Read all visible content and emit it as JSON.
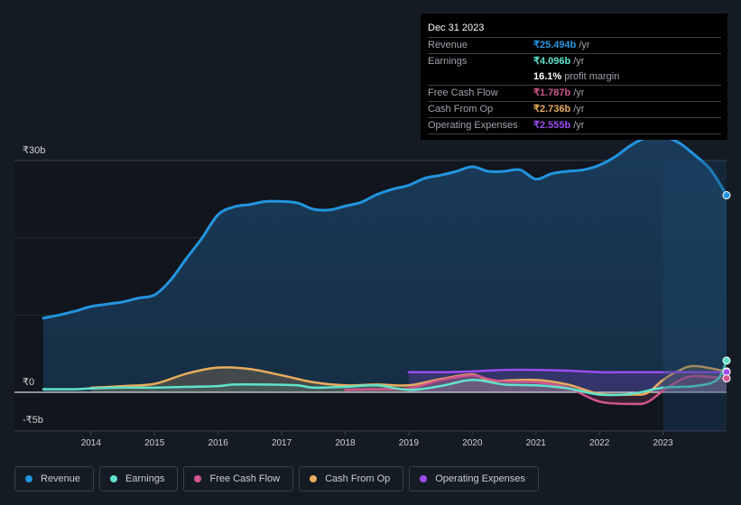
{
  "tooltip": {
    "date": "Dec 31 2023",
    "rows": [
      {
        "label": "Revenue",
        "value": "₹25.494b",
        "unit": "/yr",
        "color": "#2394df"
      },
      {
        "label": "Earnings",
        "value": "₹4.096b",
        "unit": "/yr",
        "color": "#5fe3cd"
      },
      {
        "label": "",
        "value": "16.1%",
        "unit": "profit margin",
        "color": "#ffffff"
      },
      {
        "label": "Free Cash Flow",
        "value": "₹1.787b",
        "unit": "/yr",
        "color": "#d1568e"
      },
      {
        "label": "Cash From Op",
        "value": "₹2.736b",
        "unit": "/yr",
        "color": "#e8ac5e"
      },
      {
        "label": "Operating Expenses",
        "value": "₹2.555b",
        "unit": "/yr",
        "color": "#9d4cf0"
      }
    ]
  },
  "legend": [
    {
      "label": "Revenue",
      "color": "#2394df"
    },
    {
      "label": "Earnings",
      "color": "#5fe3cd"
    },
    {
      "label": "Free Cash Flow",
      "color": "#d1568e"
    },
    {
      "label": "Cash From Op",
      "color": "#e8ac5e"
    },
    {
      "label": "Operating Expenses",
      "color": "#9d4cf0"
    }
  ],
  "chart_data": {
    "type": "area",
    "title": "",
    "xlabel": "",
    "ylabel": "",
    "ylim": [
      -5,
      30
    ],
    "xlim": [
      2013.25,
      2024.0
    ],
    "y_ticks": [
      {
        "value": 30,
        "label": "₹30b"
      },
      {
        "value": 0,
        "label": "₹0"
      },
      {
        "value": -5,
        "label": "-₹5b"
      }
    ],
    "x_ticks": [
      "2014",
      "2015",
      "2016",
      "2017",
      "2018",
      "2019",
      "2020",
      "2021",
      "2022",
      "2023"
    ],
    "highlight_from": 2023.0,
    "grid": true,
    "series": [
      {
        "name": "Revenue",
        "color": "#2394df",
        "points": [
          [
            2013.25,
            9.6
          ],
          [
            2013.5,
            10.0
          ],
          [
            2013.75,
            10.5
          ],
          [
            2014.0,
            11.1
          ],
          [
            2014.25,
            11.4
          ],
          [
            2014.5,
            11.7
          ],
          [
            2014.75,
            12.2
          ],
          [
            2015.0,
            12.6
          ],
          [
            2015.25,
            14.5
          ],
          [
            2015.5,
            17.3
          ],
          [
            2015.75,
            20.0
          ],
          [
            2016.0,
            23.0
          ],
          [
            2016.25,
            24.0
          ],
          [
            2016.5,
            24.3
          ],
          [
            2016.75,
            24.7
          ],
          [
            2017.0,
            24.7
          ],
          [
            2017.25,
            24.5
          ],
          [
            2017.5,
            23.7
          ],
          [
            2017.75,
            23.6
          ],
          [
            2018.0,
            24.1
          ],
          [
            2018.25,
            24.6
          ],
          [
            2018.5,
            25.6
          ],
          [
            2018.75,
            26.3
          ],
          [
            2019.0,
            26.8
          ],
          [
            2019.25,
            27.7
          ],
          [
            2019.5,
            28.1
          ],
          [
            2019.75,
            28.6
          ],
          [
            2020.0,
            29.2
          ],
          [
            2020.25,
            28.6
          ],
          [
            2020.5,
            28.6
          ],
          [
            2020.75,
            28.8
          ],
          [
            2021.0,
            27.6
          ],
          [
            2021.25,
            28.3
          ],
          [
            2021.5,
            28.6
          ],
          [
            2021.75,
            28.8
          ],
          [
            2022.0,
            29.4
          ],
          [
            2022.25,
            30.5
          ],
          [
            2022.5,
            32.0
          ],
          [
            2022.75,
            33.0
          ],
          [
            2023.0,
            33.1
          ],
          [
            2023.25,
            32.3
          ],
          [
            2023.5,
            30.7
          ],
          [
            2023.75,
            28.8
          ],
          [
            2024.0,
            25.5
          ]
        ]
      },
      {
        "name": "Earnings",
        "color": "#5fe3cd",
        "points": [
          [
            2013.25,
            0.4
          ],
          [
            2013.75,
            0.4
          ],
          [
            2014.0,
            0.5
          ],
          [
            2014.5,
            0.6
          ],
          [
            2015.0,
            0.6
          ],
          [
            2015.5,
            0.7
          ],
          [
            2016.0,
            0.8
          ],
          [
            2016.25,
            1.0
          ],
          [
            2016.75,
            1.0
          ],
          [
            2017.25,
            0.9
          ],
          [
            2017.5,
            0.6
          ],
          [
            2018.0,
            0.7
          ],
          [
            2018.5,
            0.9
          ],
          [
            2019.0,
            0.3
          ],
          [
            2019.5,
            0.8
          ],
          [
            2020.0,
            1.6
          ],
          [
            2020.5,
            1.0
          ],
          [
            2021.0,
            0.9
          ],
          [
            2021.5,
            0.5
          ],
          [
            2022.0,
            -0.3
          ],
          [
            2022.5,
            -0.2
          ],
          [
            2023.0,
            0.6
          ],
          [
            2023.5,
            0.8
          ],
          [
            2023.85,
            1.6
          ],
          [
            2024.0,
            4.1
          ]
        ]
      },
      {
        "name": "Free Cash Flow",
        "color": "#d1568e",
        "points": [
          [
            2018.0,
            0.3
          ],
          [
            2018.5,
            0.4
          ],
          [
            2019.0,
            0.5
          ],
          [
            2019.5,
            1.6
          ],
          [
            2020.0,
            2.2
          ],
          [
            2020.25,
            1.7
          ],
          [
            2020.5,
            1.4
          ],
          [
            2021.0,
            1.3
          ],
          [
            2021.5,
            0.6
          ],
          [
            2022.0,
            -1.2
          ],
          [
            2022.5,
            -1.5
          ],
          [
            2022.75,
            -1.3
          ],
          [
            2023.0,
            0.2
          ],
          [
            2023.25,
            1.5
          ],
          [
            2023.5,
            2.1
          ],
          [
            2024.0,
            1.8
          ]
        ]
      },
      {
        "name": "Cash From Op",
        "color": "#e8ac5e",
        "points": [
          [
            2014.0,
            0.6
          ],
          [
            2014.5,
            0.8
          ],
          [
            2015.0,
            1.1
          ],
          [
            2015.5,
            2.4
          ],
          [
            2016.0,
            3.2
          ],
          [
            2016.5,
            3.0
          ],
          [
            2017.0,
            2.2
          ],
          [
            2017.5,
            1.3
          ],
          [
            2018.0,
            0.9
          ],
          [
            2018.5,
            1.0
          ],
          [
            2019.0,
            0.9
          ],
          [
            2019.5,
            1.7
          ],
          [
            2020.0,
            2.3
          ],
          [
            2020.25,
            1.5
          ],
          [
            2020.5,
            1.5
          ],
          [
            2021.0,
            1.6
          ],
          [
            2021.5,
            1.0
          ],
          [
            2022.0,
            -0.2
          ],
          [
            2022.5,
            -0.3
          ],
          [
            2022.75,
            -0.1
          ],
          [
            2023.0,
            1.6
          ],
          [
            2023.25,
            2.8
          ],
          [
            2023.5,
            3.4
          ],
          [
            2024.0,
            2.7
          ]
        ]
      },
      {
        "name": "Operating Expenses",
        "color": "#9d4cf0",
        "points": [
          [
            2019.0,
            2.6
          ],
          [
            2019.5,
            2.6
          ],
          [
            2020.0,
            2.7
          ],
          [
            2020.5,
            2.9
          ],
          [
            2021.0,
            2.9
          ],
          [
            2021.5,
            2.8
          ],
          [
            2022.0,
            2.6
          ],
          [
            2022.5,
            2.6
          ],
          [
            2023.0,
            2.6
          ],
          [
            2023.5,
            2.6
          ],
          [
            2024.0,
            2.6
          ]
        ]
      }
    ]
  }
}
